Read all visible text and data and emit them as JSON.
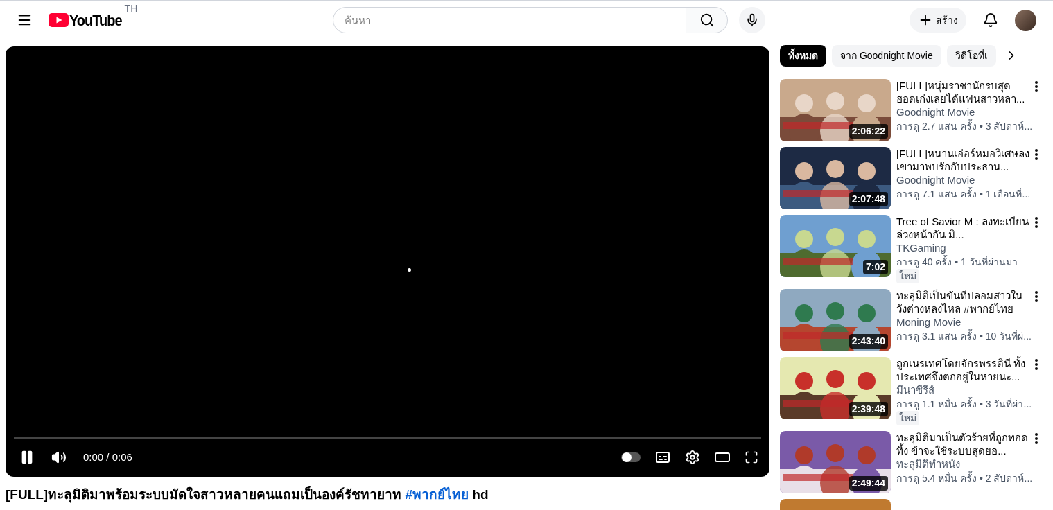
{
  "header": {
    "logo_text": "YouTube",
    "region": "TH",
    "search": {
      "placeholder": "ค้นหา"
    },
    "create_label": "สร้าง"
  },
  "player": {
    "playing": true,
    "time": "0:00 / 0:06",
    "autoplay": false
  },
  "video_title": {
    "before": "[FULL]ทะลุมิติมาพร้อมระบบมัดใจสาวหลายคนแถมเป็นองค์รัชทายาท",
    "hashtag": "#พากย์ไทย",
    "after": "hd"
  },
  "chips": [
    {
      "label": "ทั้งหมด",
      "selected": true
    },
    {
      "label": "จาก Goodnight Movie",
      "selected": false
    },
    {
      "label": "วิดีโอที่เ",
      "selected": false
    }
  ],
  "recommendations": [
    {
      "title": "[FULL]หนุ่มราชานักรบสุดฮอดเก่งเลยได้แฟนสาวหลา...",
      "channel": "Goodnight Movie",
      "meta": "การดู 2.7 แสน ครั้ง • 3 สัปดาห์...",
      "duration": "2:06:22"
    },
    {
      "title": "[FULL]หนานเอ๋อร์หมอวิเศษลงเขามาพบรักกับประธาน...",
      "channel": "Goodnight Movie",
      "meta": "การดู 7.1 แสน ครั้ง • 1 เดือนที่...",
      "duration": "2:07:48"
    },
    {
      "title": "Tree of Savior M : ลงทะเบียนล่วงหน้ากัน มิ...",
      "channel": "TKGaming",
      "meta": "การดู 40 ครั้ง • 1 วันที่ผ่านมา",
      "duration": "7:02",
      "new": true,
      "new_label": "ใหม่"
    },
    {
      "title": "ทะลุมิติเป็นขันทีปลอมสาวในวังต่างหลงไหล #พากย์ไทย",
      "channel": "Moning Movie",
      "meta": "การดู 3.1 แสน ครั้ง • 10 วันที่ผ่...",
      "duration": "2:43:40"
    },
    {
      "title": "ถูกเนรเทศโดยจักรพรรดินี ทั้งประเทศจึงตกอยู่ในหายนะ...",
      "channel": "มีนาซีรีส์",
      "meta": "การดู 1.1 หมื่น ครั้ง • 3 วันที่ผ่า...",
      "duration": "2:39:48",
      "new": true,
      "new_label": "ใหม่"
    },
    {
      "title": "ทะลุมิติมาเป็นตัวร้ายที่ถูกทอดทิ้ง ข้าจะใช้ระบบสุดยอ...",
      "channel": "ทะลุมิติทำหนัง",
      "meta": "การดู 5.4 หมื่น ครั้ง • 2 สัปดาห์...",
      "duration": "2:49:44"
    }
  ]
}
